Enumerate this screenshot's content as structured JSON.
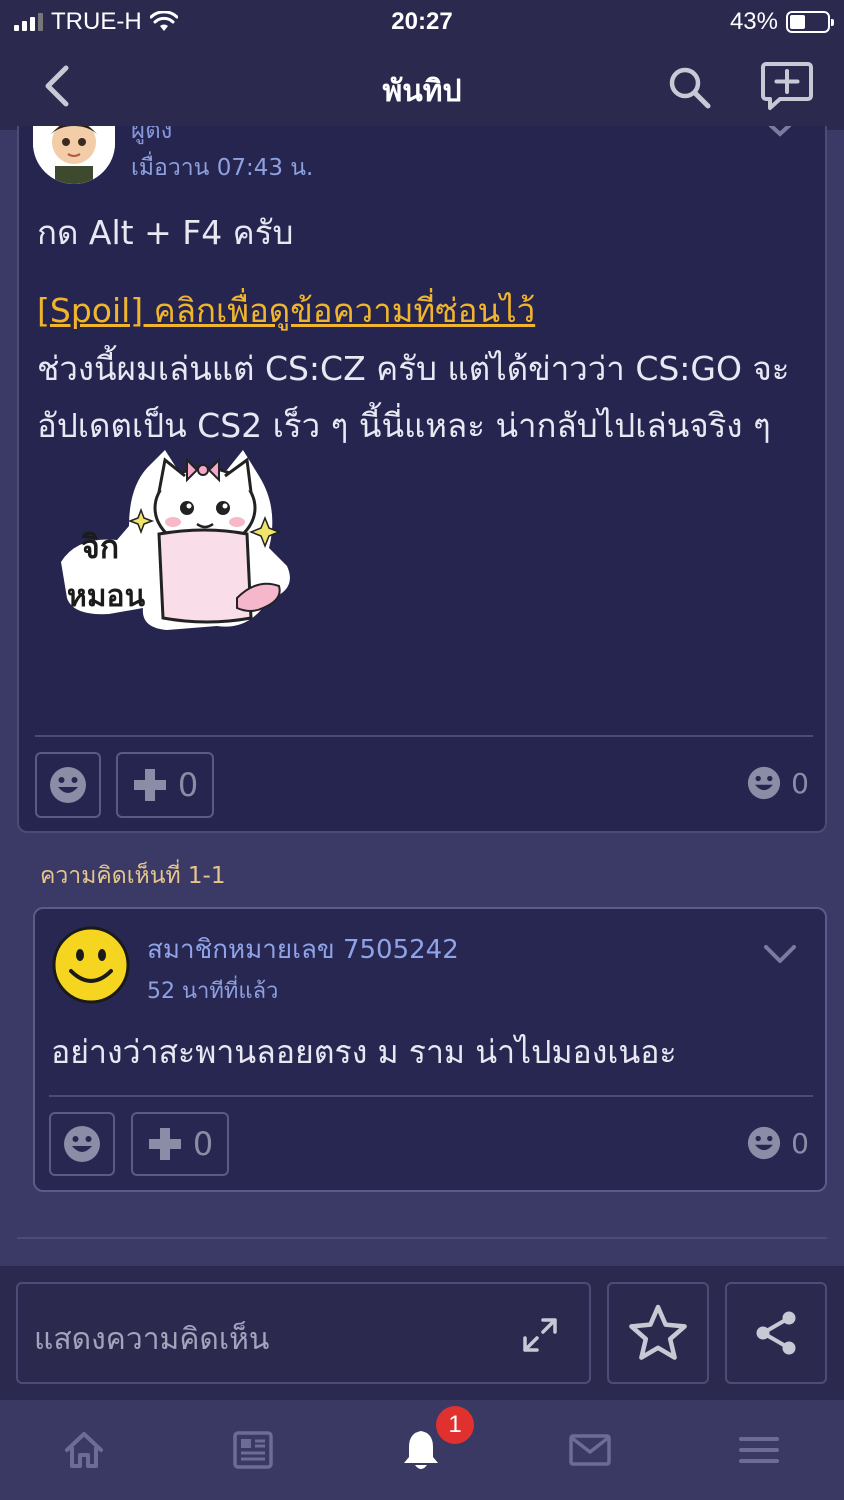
{
  "status_bar": {
    "carrier": "TRUE-H",
    "time": "20:27",
    "battery": "43%"
  },
  "nav": {
    "title": "พันทิป"
  },
  "post": {
    "username": "ผู้ตั้ง",
    "time": "เมื่อวาน  07:43 น.",
    "line1": "กด Alt + F4 ครับ",
    "spoil": "[Spoil] คลิกเพื่อดูข้อความที่ซ่อนไว้",
    "body": "ช่วงนี้ผมเล่นแต่ CS:CZ ครับ แต่ได้ข่าวว่า CS:GO จะอัปเดตเป็น CS2 เร็ว ๆ นี้นี่แหละ น่ากลับไปเล่นจริง ๆ",
    "sticker_text": [
      "จิก",
      "หมอน"
    ],
    "plus_count": "0",
    "emotion_count": "0"
  },
  "reply": {
    "label": "ความคิดเห็นที่ 1-1",
    "username": "สมาชิกหมายเลข 7505242",
    "time": "52 นาทีที่แล้ว",
    "text": "อย่างว่าสะพานลอยตรง ม ราม น่าไปมองเนอะ",
    "plus_count": "0",
    "emotion_count": "0"
  },
  "comment_bar": {
    "placeholder": "แสดงความคิดเห็น"
  },
  "tabbar": {
    "notification_badge": "1",
    "tabs": [
      "home-icon",
      "feed-icon",
      "bell-icon",
      "mail-icon",
      "menu-icon"
    ]
  },
  "colors": {
    "background": "#3b3a66",
    "card": "#262550",
    "spoil": "#f1b52d",
    "username": "#8fa3e8",
    "badge": "#e0312f"
  }
}
